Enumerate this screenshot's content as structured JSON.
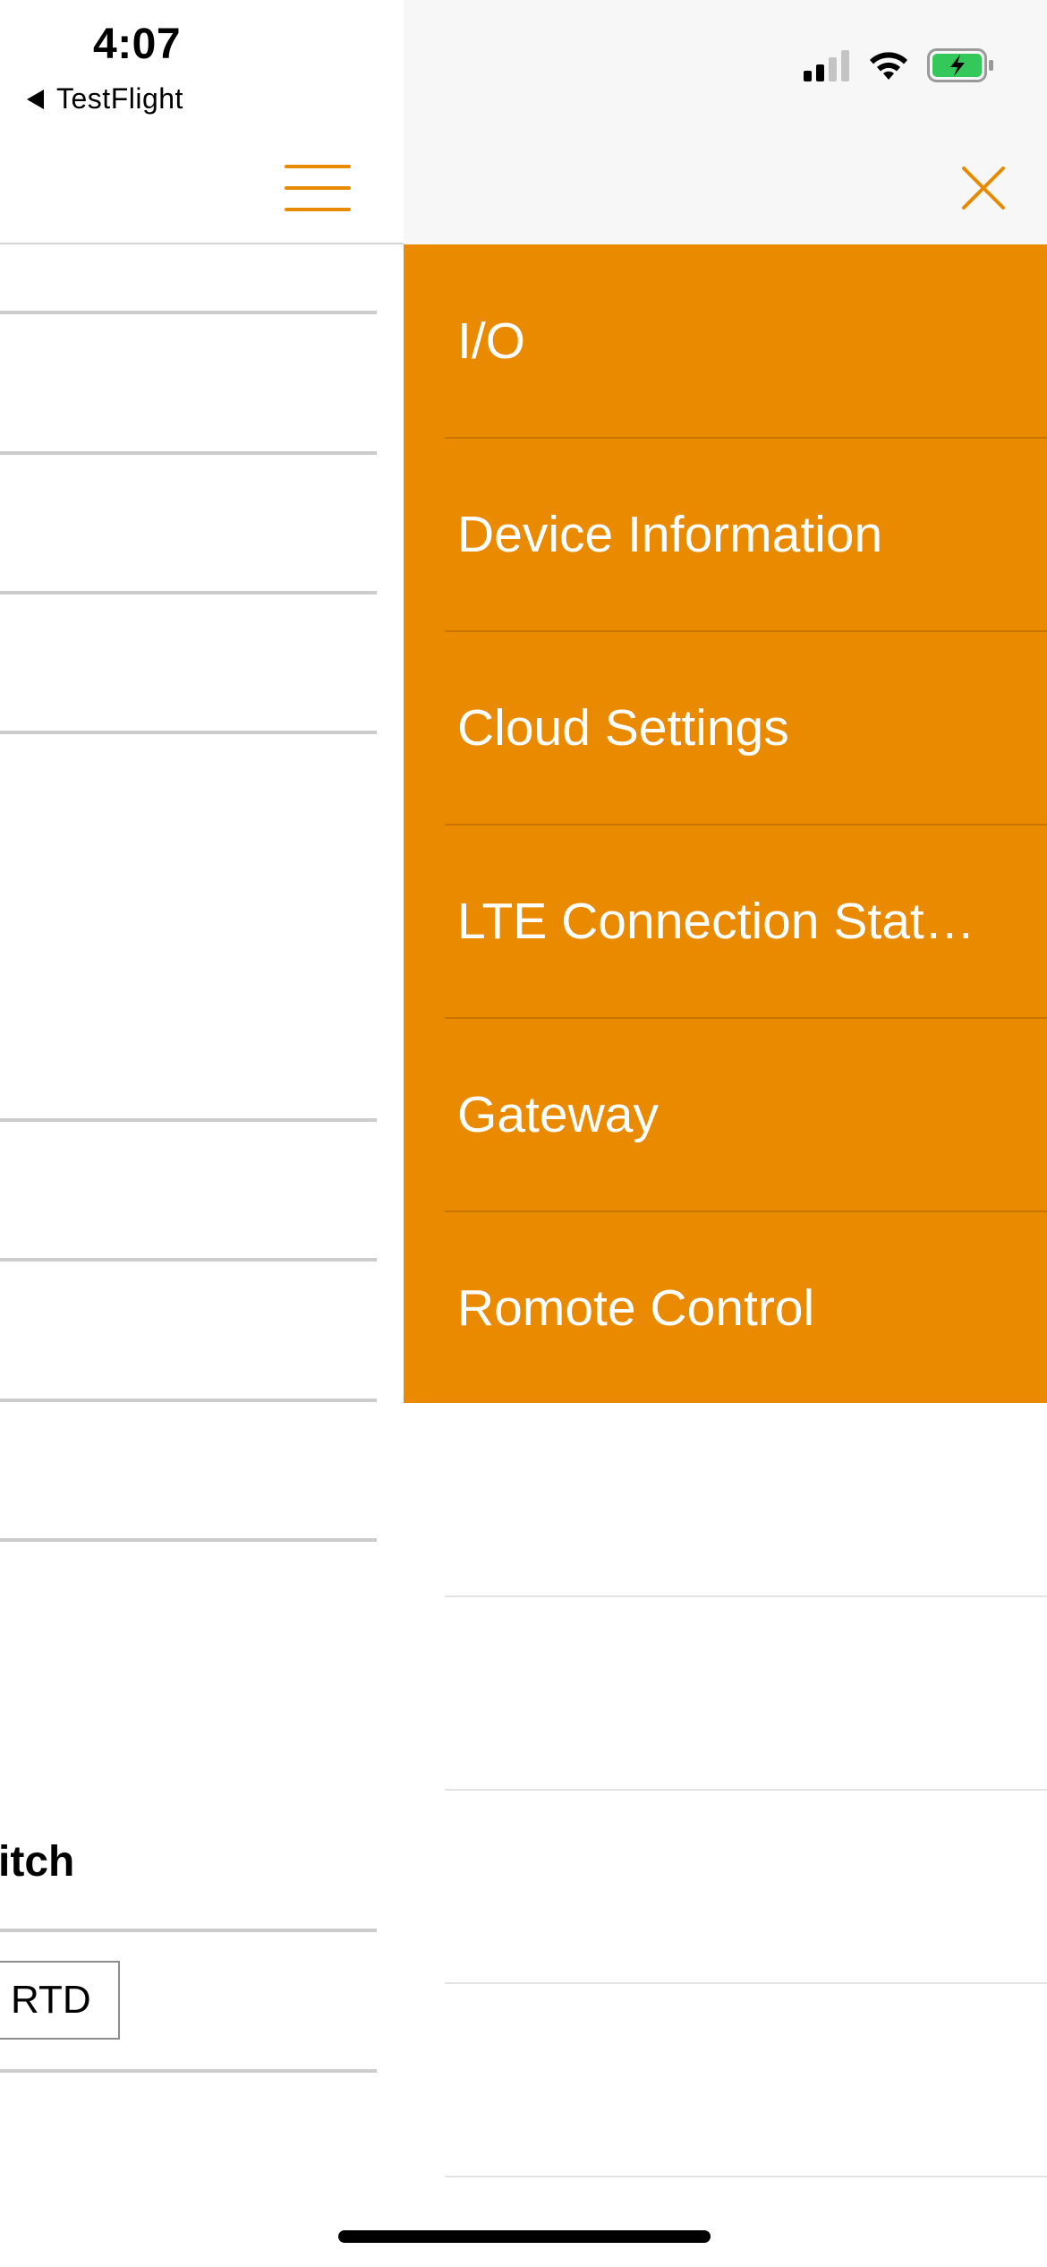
{
  "status_bar": {
    "time": "4:07",
    "back_app": "TestFlight"
  },
  "underlying_page": {
    "partial_heading": "itch",
    "rtd_label": "RTD"
  },
  "drawer": {
    "menu_items": [
      {
        "label": "I/O"
      },
      {
        "label": "Device Information"
      },
      {
        "label": "Cloud Settings"
      },
      {
        "label": "LTE Connection Stat…"
      },
      {
        "label": "Gateway"
      },
      {
        "label": "Romote Control"
      }
    ]
  },
  "colors": {
    "accent": "#ea8a00",
    "drawer_header_bg": "#f7f7f7",
    "battery_fill": "#34c759"
  },
  "icons": [
    "back-arrow-icon",
    "hamburger-menu-icon",
    "close-icon",
    "cellular-signal-icon",
    "wifi-icon",
    "battery-charging-icon"
  ]
}
